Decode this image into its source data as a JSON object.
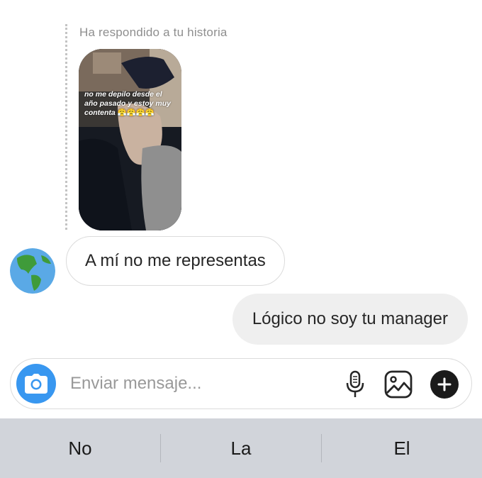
{
  "story": {
    "caption": "Ha respondido a tu historia",
    "overlay_text": "no me depilo desde el año pasado y estoy muy contenta",
    "overlay_emoji": "😤😤😤😤"
  },
  "messages": [
    {
      "direction": "incoming",
      "text": "A mí no me representas"
    },
    {
      "direction": "outgoing",
      "text": "Lógico no soy tu manager"
    }
  ],
  "composer": {
    "placeholder": "Enviar mensaje...",
    "value": "",
    "icons": [
      "camera-icon",
      "microphone-icon",
      "gallery-icon",
      "plus-icon"
    ]
  },
  "keyboard": {
    "suggestions": [
      "No",
      "La",
      "El"
    ]
  },
  "colors": {
    "accent": "#3897f0",
    "outgoing_bubble": "#efefef",
    "keyboard_bar": "#d1d4da"
  }
}
